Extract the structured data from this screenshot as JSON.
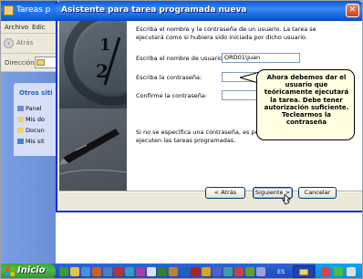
{
  "background_window": {
    "title": "Tareas p",
    "menu": [
      "Archivo",
      "Edic"
    ],
    "back_label": "Atrás",
    "address_label": "Dirección",
    "panel_header": "Otros siti",
    "places": [
      "Panel",
      "Mis do",
      "Docun",
      "Mis sit"
    ]
  },
  "wizard": {
    "title": "Asistente para tarea programada nueva",
    "instruction": "Escriba el nombre y la contraseña de un usuario. La tarea se ejecutará como si hubiera sido iniciada por dicho usuario.",
    "username_label": "Escriba el nombre de usuario:",
    "username_value": "ORD01\\juan",
    "password_label": "Escriba la contraseña:",
    "password_value": "",
    "confirm_label": "Confirme la contraseña:",
    "confirm_value": "",
    "note": "Si no se especifica una contraseña, es posible que no se ejecuten las tareas programadas.",
    "buttons": {
      "back": "< Atrás",
      "next": "Siguiente >",
      "cancel": "Cancelar"
    }
  },
  "callout": {
    "text": "Ahora debemos dar el usuario que teóricamente ejecutará la tarea. Debe tener autorización suficiente. Teclearmos la contraseña"
  },
  "taskbar": {
    "start_label": "Inicio",
    "language": "ES"
  },
  "colors": {
    "titlebar": "#0a5ad8",
    "callout_bg": "#ffffe1",
    "start_green": "#3fa63f",
    "taskbar_blue": "#2457c8"
  }
}
